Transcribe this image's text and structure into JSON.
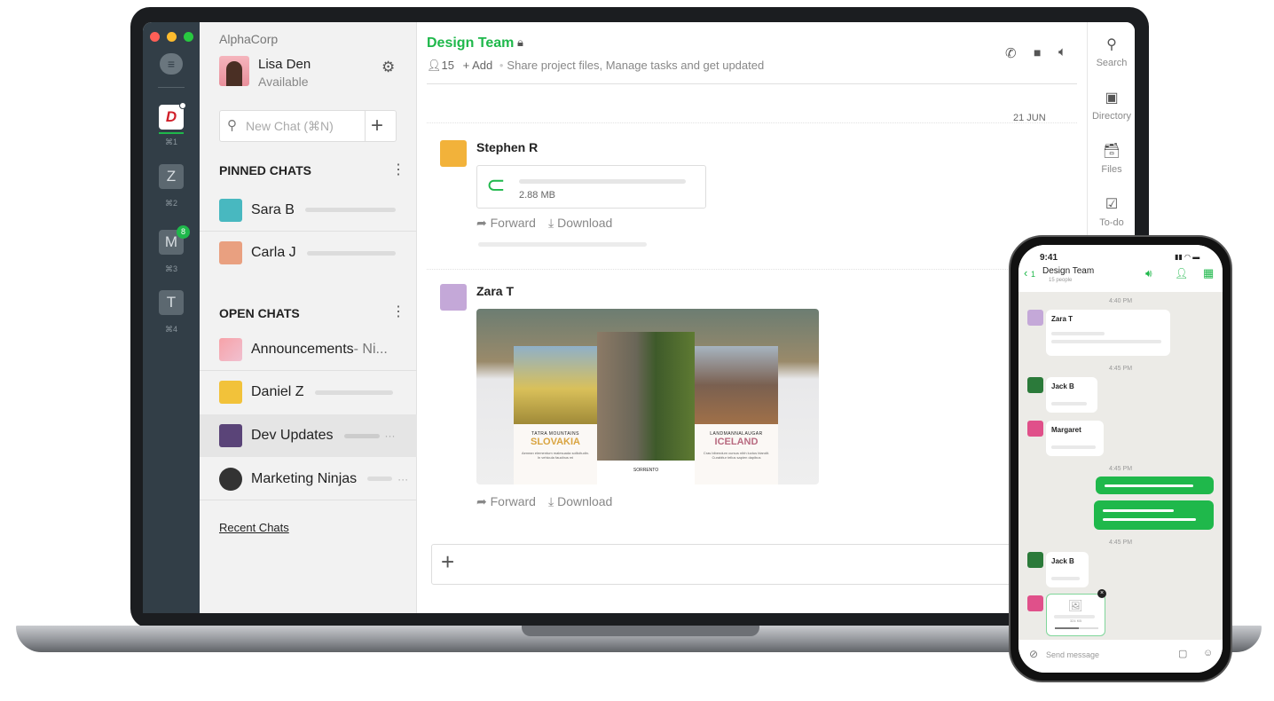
{
  "workspace": {
    "name": "AlphaCorp",
    "user": {
      "name": "Lisa Den",
      "status": "Available"
    }
  },
  "rail": {
    "items": [
      {
        "label": "D",
        "shortcut": "⌘1"
      },
      {
        "label": "Z",
        "shortcut": "⌘2"
      },
      {
        "label": "M",
        "shortcut": "⌘3",
        "badge": "8"
      },
      {
        "label": "T",
        "shortcut": "⌘4"
      }
    ]
  },
  "search": {
    "placeholder": "New Chat (⌘N)"
  },
  "pinned": {
    "title": "PINNED CHATS",
    "items": [
      {
        "name": "Sara B"
      },
      {
        "name": "Carla J"
      }
    ]
  },
  "open": {
    "title": "OPEN CHATS",
    "items": [
      {
        "name": "Announcements",
        "suffix": " - Ni..."
      },
      {
        "name": "Daniel Z"
      },
      {
        "name": "Dev Updates"
      },
      {
        "name": "Marketing Ninjas"
      }
    ]
  },
  "recent_link": "Recent Chats",
  "channel": {
    "title": "Design Team",
    "members": "15",
    "add": "+ Add",
    "description": "Share project files, Manage tasks and get updated"
  },
  "date_divider": "21 JUN",
  "messages": [
    {
      "author": "Stephen R",
      "file_size": "2.88 MB",
      "forward": "Forward",
      "download": "Download"
    },
    {
      "author": "Zara T",
      "forward": "Forward",
      "download": "Download",
      "image": {
        "left": {
          "sub": "TATRA MOUNTAINS",
          "title": "SLOVAKIA",
          "text": "Aenean elementum malesuada sollicitudin. In vehicula faucibus mi"
        },
        "center": {
          "title": "SORRENTO"
        },
        "right": {
          "sub": "LANDMANNALAUGAR",
          "title": "ICELAND",
          "text": "Cras bibendum cursus nibh luctus blandit. Curabitur tellus sapien dapibus"
        }
      }
    }
  ],
  "right_rail": [
    {
      "icon": "search-icon",
      "label": "Search"
    },
    {
      "icon": "directory-icon",
      "label": "Directory"
    },
    {
      "icon": "files-icon",
      "label": "Files"
    },
    {
      "icon": "todo-icon",
      "label": "To-do"
    }
  ],
  "phone": {
    "time": "9:41",
    "back_count": "1",
    "title": "Design Team",
    "subtitle": "15 people",
    "times": [
      "4:40 PM",
      "4:45 PM",
      "4:45 PM",
      "4:45 PM"
    ],
    "senders": [
      "Zara T",
      "Jack B",
      "Margaret",
      "Jack B"
    ],
    "upload_size": "324 KB",
    "upload_progress": 0.55,
    "input_placeholder": "Send message"
  },
  "colors": {
    "accent": "#1fb84b",
    "rail": "#323e47"
  }
}
